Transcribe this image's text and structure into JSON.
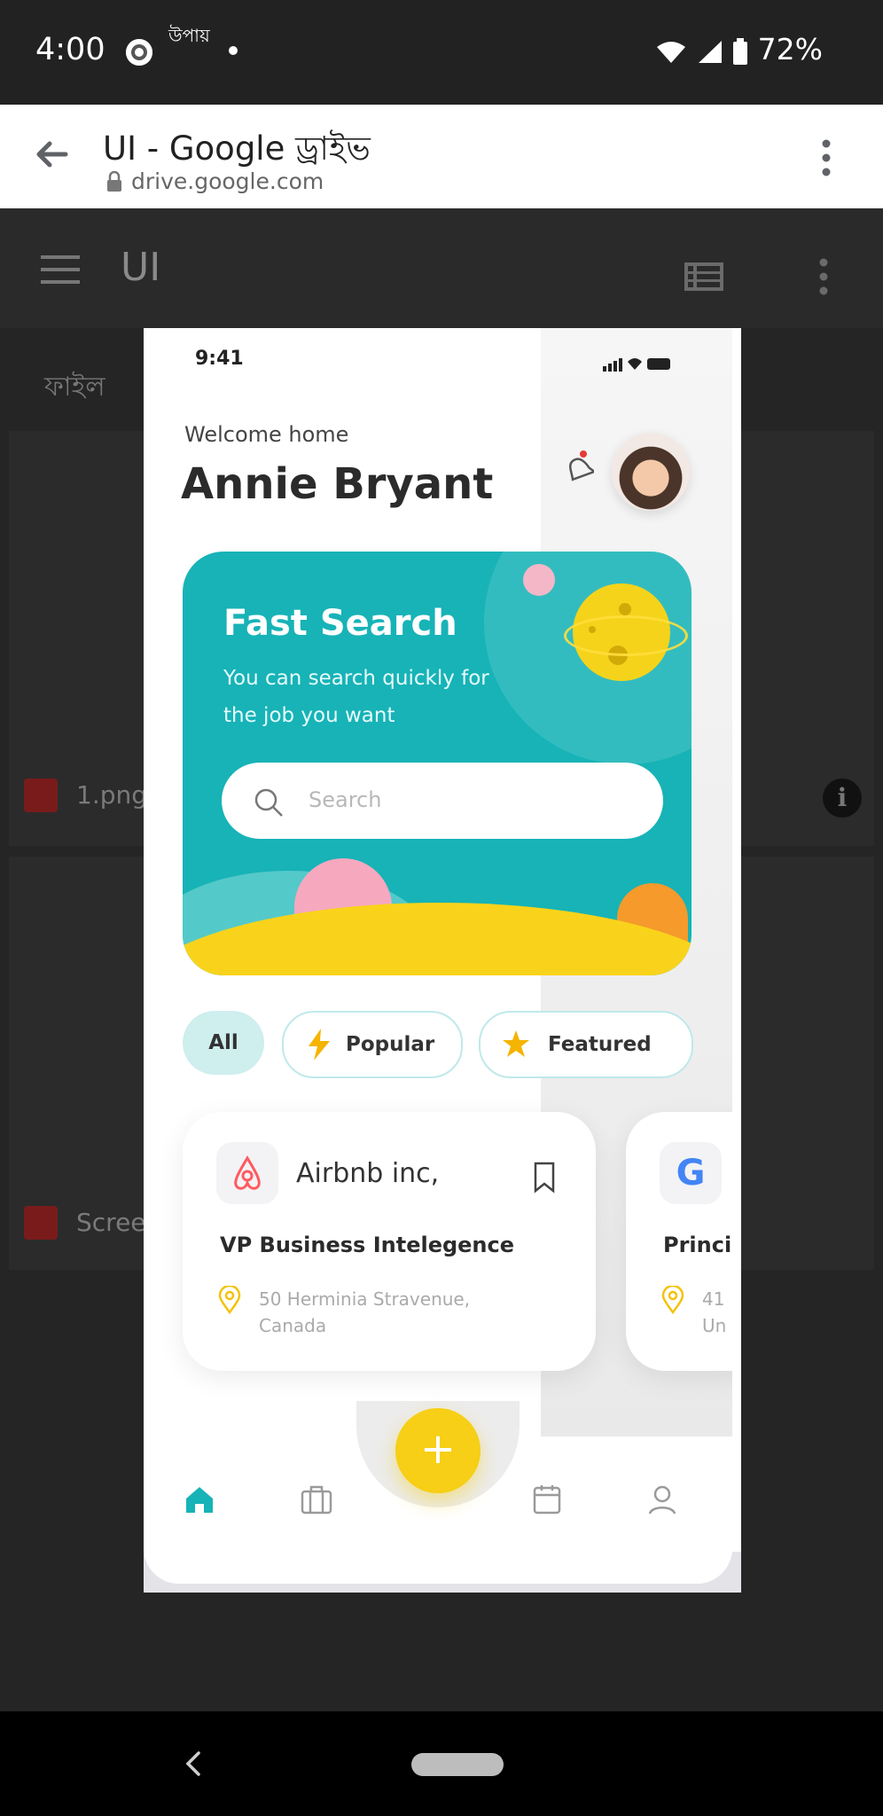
{
  "status_bar": {
    "time": "4:00",
    "app_label": "উপায়",
    "battery": "72%"
  },
  "browser": {
    "title": "UI - Google ড্রাইভ",
    "url": "drive.google.com"
  },
  "drive": {
    "folder_title": "UI",
    "files_section": "ফাইল",
    "files": [
      {
        "name": "1.png"
      },
      {
        "name": "Scree"
      }
    ]
  },
  "preview": {
    "time": "9:41",
    "welcome": "Welcome home",
    "user_name": "Annie Bryant",
    "hero": {
      "title": "Fast Search",
      "subtitle": "You can search quickly for the job you want",
      "search_placeholder": "Search"
    },
    "filters": [
      {
        "label": "All",
        "icon": "none",
        "active": true
      },
      {
        "label": "Popular",
        "icon": "lightning-icon",
        "active": false
      },
      {
        "label": "Featured",
        "icon": "star-icon",
        "active": false
      }
    ],
    "jobs": [
      {
        "company": "Airbnb inc,",
        "title": "VP Business Intelegence",
        "address": "50 Herminia Stravenue, Canada",
        "logo": "airbnb-icon"
      },
      {
        "company": "G",
        "title": "Princip",
        "address": "41 Un",
        "logo": "google-icon"
      }
    ],
    "fab_label": "+",
    "tabs": [
      "home-icon",
      "briefcase-icon",
      "calendar-icon",
      "profile-icon"
    ]
  },
  "colors": {
    "accent": "#17b3b7",
    "fab": "#f6cf16",
    "background": "#1f1f1f"
  }
}
